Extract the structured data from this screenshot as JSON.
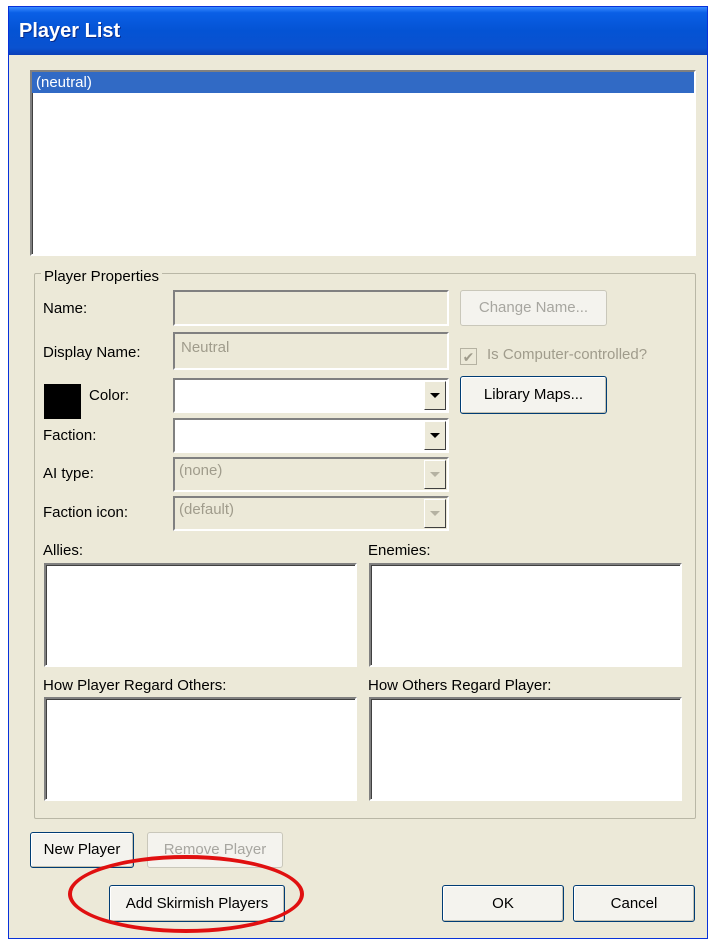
{
  "window": {
    "title": "Player List"
  },
  "players_list": {
    "items": [
      "(neutral)"
    ],
    "selected": "(neutral)"
  },
  "properties": {
    "group_label": "Player Properties",
    "name_label": "Name:",
    "name_value": "",
    "change_name_button": "Change Name...",
    "display_name_label": "Display Name:",
    "display_name_value": "Neutral",
    "computer_controlled_label": "Is Computer-controlled?",
    "computer_controlled_checked": true,
    "color_label": "Color:",
    "color_value": "#000000",
    "library_maps_button": "Library Maps...",
    "faction_label": "Faction:",
    "faction_value": "",
    "ai_type_label": "AI type:",
    "ai_type_value": "(none)",
    "faction_icon_label": "Faction icon:",
    "faction_icon_value": "(default)",
    "allies_label": "Allies:",
    "enemies_label": "Enemies:",
    "regard_others_label": "How Player Regard Others:",
    "others_regard_label": "How Others Regard Player:"
  },
  "buttons": {
    "new_player": "New Player",
    "remove_player": "Remove Player",
    "add_skirmish": "Add Skirmish Players",
    "ok": "OK",
    "cancel": "Cancel"
  },
  "colors": {
    "titlebar": "#0453d4",
    "selection": "#316ac5",
    "highlight_ellipse": "#e01010"
  }
}
